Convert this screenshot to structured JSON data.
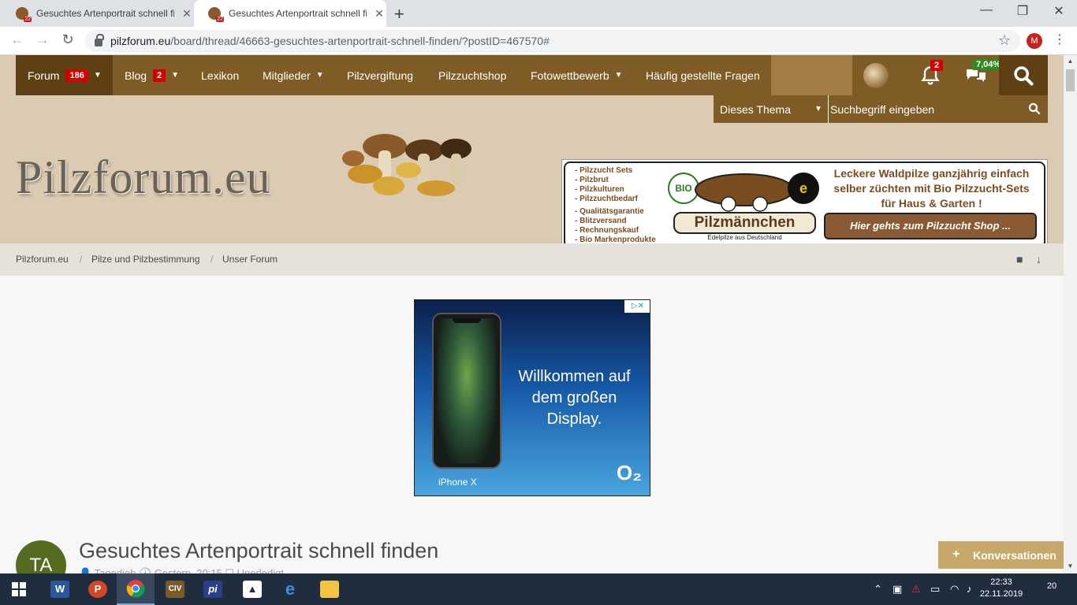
{
  "browser": {
    "tabs": [
      {
        "title": "Gesuchtes Artenportrait schnell fi",
        "active": false
      },
      {
        "title": "Gesuchtes Artenportrait schnell fi",
        "active": true
      }
    ],
    "url_host": "pilzforum.eu",
    "url_path": "/board/thread/46663-gesuchtes-artenportrait-schnell-finden/?postID=467570#",
    "profile_initial": "M"
  },
  "nav": {
    "items": [
      {
        "label": "Forum",
        "badge": "186",
        "caret": true,
        "active": true
      },
      {
        "label": "Blog",
        "badge": "2",
        "caret": true
      },
      {
        "label": "Lexikon"
      },
      {
        "label": "Mitglieder",
        "caret": true
      },
      {
        "label": "Pilzvergiftung"
      },
      {
        "label": "Pilzzuchtshop"
      },
      {
        "label": "Fotowettbewerb",
        "caret": true
      },
      {
        "label": "Häufig gestellte Fragen"
      }
    ],
    "notifications_badge": "2",
    "conversations_badge": "7,04%"
  },
  "search": {
    "scope": "Dieses Thema",
    "placeholder": "Suchbegriff eingeben"
  },
  "header": {
    "logo_text": "Pilzforum.eu"
  },
  "banner": {
    "list_top": [
      "- Pilzzucht Sets",
      "- Pilzbrut",
      "- Pilzkulturen",
      "- Pilzzuchtbedarf"
    ],
    "list_bottom": [
      "- Qualitätsgarantie",
      "- Blitzversand",
      "- Rechnungskauf",
      "- Bio Markenprodukte"
    ],
    "bio_label": "BIO",
    "trusted_label": "e",
    "brand": "Pilzmännchen",
    "brand_sub": "Edelpilze aus Deutschland",
    "headline": "Leckere Waldpilze ganzjährig einfach selber züchten mit Bio Pilzzucht-Sets für Haus & Garten !",
    "cta": "Hier gehts zum Pilzzucht Shop ..."
  },
  "breadcrumbs": [
    "Pilzforum.eu",
    "Pilze und Pilzbestimmung",
    "Unser Forum"
  ],
  "ad": {
    "tagline": "Willkommen auf dem großen Display.",
    "model": " iPhone X",
    "brand": "O₂"
  },
  "thread": {
    "avatar_initials": "TA",
    "title": "Gesuchtes Artenportrait schnell finden",
    "meta": "👤 Tagedieb   🕓 Gestern, 20:15   ☐ Unerledigt"
  },
  "conversations_tab": "Konversationen",
  "taskbar": {
    "clock_time": "22:33",
    "clock_date": "22.11.2019",
    "notification_count": "20"
  },
  "colors": {
    "nav_brown": "#7f5b26",
    "nav_active": "#5f3f14",
    "header_beige": "#dccbb3",
    "badge_red": "#d40000",
    "badge_green": "#2e8b1e"
  }
}
